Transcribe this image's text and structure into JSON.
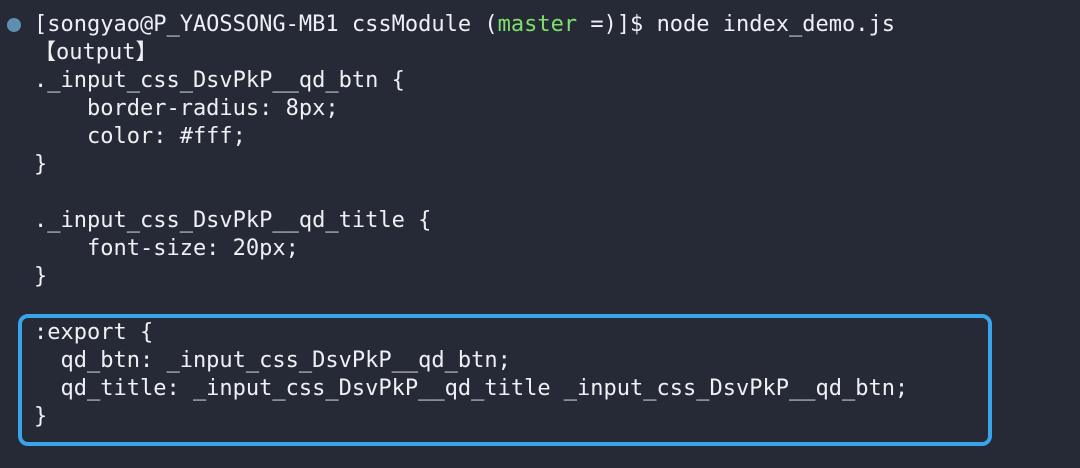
{
  "colors": {
    "background": "#262a36",
    "text": "#eef0f4",
    "branch": "#7ee06a",
    "highlight_border": "#39a4ea",
    "status_dot": "#5f8fb0"
  },
  "prompt": {
    "prefix": "[songyao@P_YAOSSONG-MB1 cssModule (",
    "branch": "master",
    "suffix": " =)]$ ",
    "command": "node index_demo.js"
  },
  "output": {
    "header": "【output】",
    "lines": [
      "._input_css_DsvPkP__qd_btn {",
      "    border-radius: 8px;",
      "    color: #fff;",
      "}",
      "",
      "._input_css_DsvPkP__qd_title {",
      "    font-size: 20px;",
      "}"
    ]
  },
  "export_block": {
    "lines": [
      ":export {",
      "  qd_btn: _input_css_DsvPkP__qd_btn;",
      "  qd_title: _input_css_DsvPkP__qd_title _input_css_DsvPkP__qd_btn;",
      "}"
    ]
  }
}
